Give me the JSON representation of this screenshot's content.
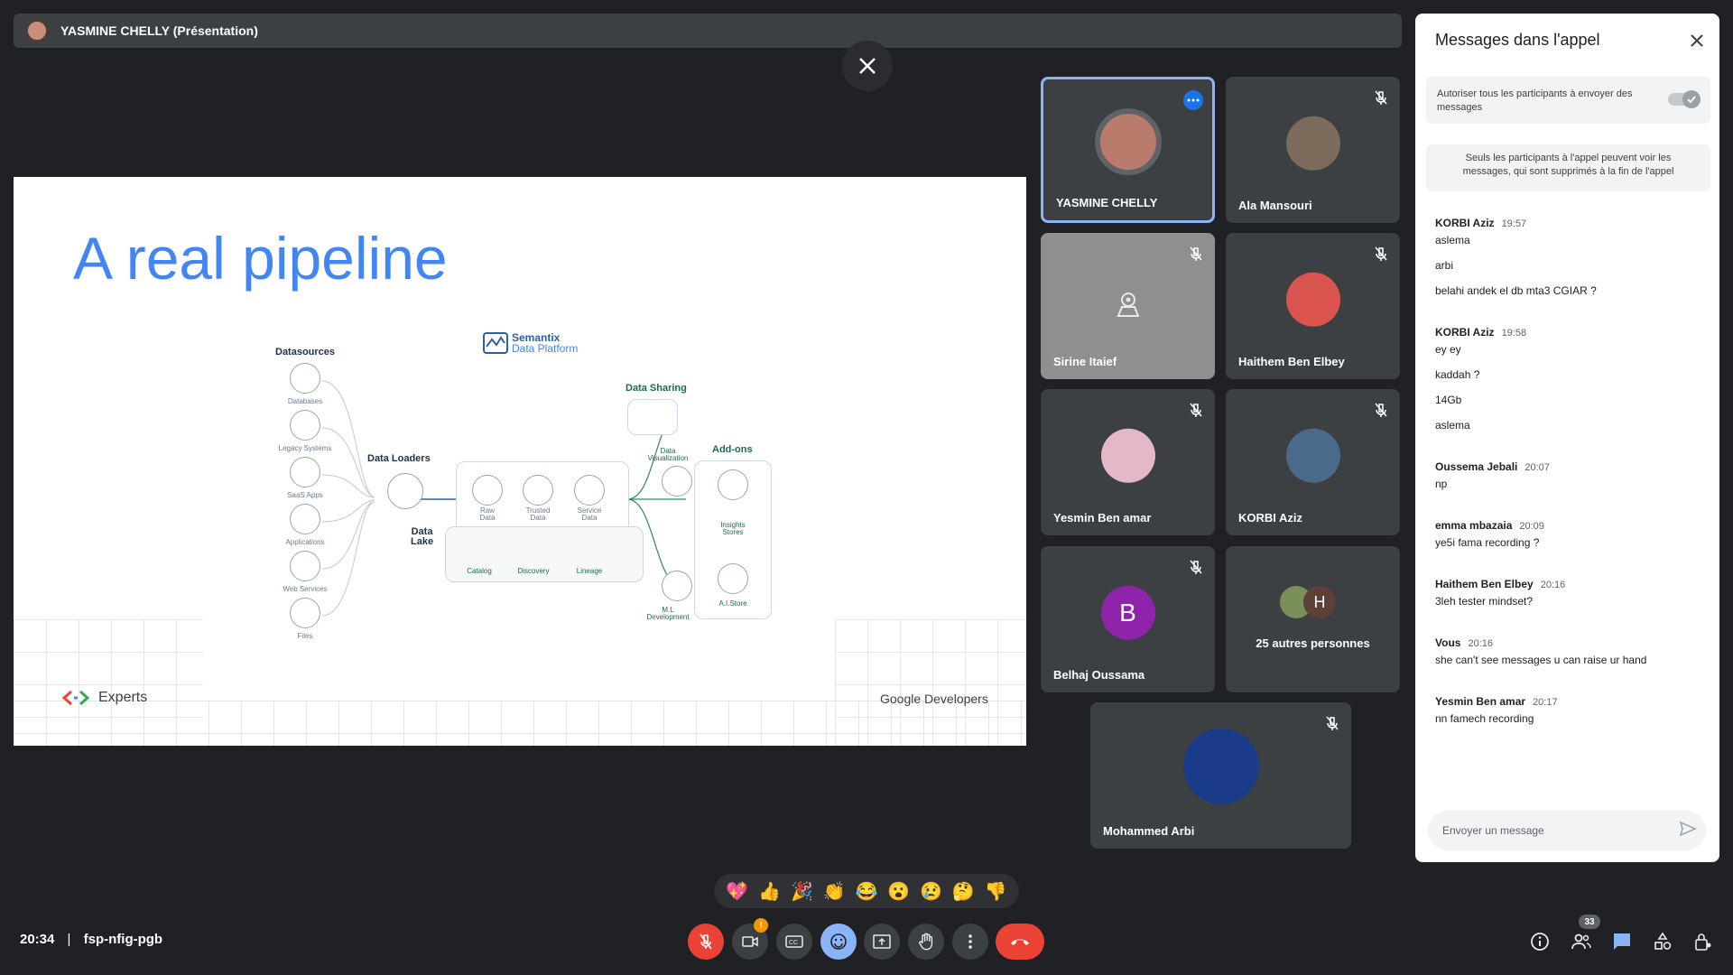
{
  "presenter_bar": {
    "label": "YASMINE CHELLY (Présentation)"
  },
  "slide": {
    "title": "A real pipeline",
    "logo_text": [
      "Semantix",
      "Data Platform"
    ],
    "sections": {
      "datasources": "Datasources",
      "data_loaders": "Data Loaders",
      "data_lake": [
        "Data",
        "Lake"
      ],
      "data_sharing": "Data Sharing",
      "addons": "Add-ons"
    },
    "sources": [
      "Databases",
      "Legacy Systems",
      "SaaS Apps",
      "Applications",
      "Web Services",
      "Files"
    ],
    "lake_items": [
      [
        "Raw",
        "Data"
      ],
      [
        "Trusted",
        "Data"
      ],
      [
        "Service",
        "Data"
      ]
    ],
    "lake_tools": [
      "Catalog",
      "Discovery",
      "Lineage"
    ],
    "sharing_items": [
      [
        "Data",
        "Visualization"
      ],
      [
        "M.L",
        "Development"
      ]
    ],
    "addon_items": [
      [
        "Insights",
        "Stores"
      ],
      [
        "A.I.Store"
      ]
    ],
    "experts": "Experts",
    "google_dev": "Google Developers"
  },
  "participants": [
    {
      "name": "YASMINE CHELLY",
      "avatar_color": "#b97c6c"
    },
    {
      "name": "Ala Mansouri",
      "avatar_color": "#7c6a5a"
    },
    {
      "name": "Sirine Itaief",
      "avatar_color": "#8e8e8e"
    },
    {
      "name": "Haithem Ben Elbey",
      "avatar_color": "#d9534f"
    },
    {
      "name": "Yesmin Ben amar",
      "avatar_color": "#e4b8c8"
    },
    {
      "name": "KORBI Aziz",
      "avatar_color": "#4a6a8a"
    },
    {
      "name": "Belhaj Oussama",
      "avatar_letter": "B",
      "avatar_color": "#8e24aa"
    },
    {
      "name": "25 autres personnes",
      "avatar_letter": "H",
      "avatar_color": "#5d4037"
    },
    {
      "name": "Mohammed Arbi",
      "avatar_color": "#1a3a8a"
    }
  ],
  "chat": {
    "title": "Messages dans l'appel",
    "allow_text": "Autoriser tous les participants à envoyer des messages",
    "info_text": "Seuls les participants à l'appel peuvent voir les messages, qui sont supprimés à la fin de l'appel",
    "input_placeholder": "Envoyer un message",
    "messages": [
      {
        "author": "KORBI Aziz",
        "time": "19:57",
        "lines": [
          "aslema",
          "arbi",
          "belahi andek el db mta3 CGIAR ?"
        ]
      },
      {
        "author": "KORBI Aziz",
        "time": "19:58",
        "lines": [
          "ey ey",
          "kaddah ?",
          "14Gb",
          "aslema"
        ]
      },
      {
        "author": "Oussema Jebali",
        "time": "20:07",
        "lines": [
          "np"
        ]
      },
      {
        "author": "emma mbazaia",
        "time": "20:09",
        "lines": [
          "ye5i fama recording ?"
        ]
      },
      {
        "author": "Haithem Ben Elbey",
        "time": "20:16",
        "lines": [
          "3leh tester mindset?"
        ]
      },
      {
        "author": "Vous",
        "time": "20:16",
        "lines": [
          "she can't see messages u can raise ur hand"
        ]
      },
      {
        "author": "Yesmin Ben amar",
        "time": "20:17",
        "lines": [
          "nn famech recording"
        ]
      }
    ]
  },
  "reactions": [
    "💖",
    "👍",
    "🎉",
    "👏",
    "😂",
    "😮",
    "😢",
    "🤔",
    "👎"
  ],
  "bottom": {
    "time": "20:34",
    "separator": "|",
    "meeting_code": "fsp-nfig-pgb",
    "participants_count": "33",
    "camera_badge": "!"
  }
}
